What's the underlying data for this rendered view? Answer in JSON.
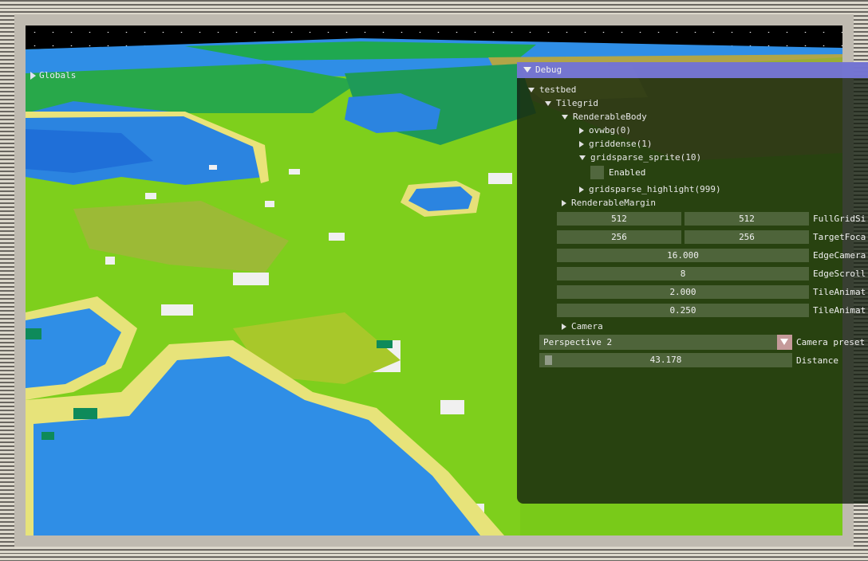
{
  "globals": {
    "label": "Globals"
  },
  "debug": {
    "title": "Debug",
    "tree": {
      "testbed": "testbed",
      "tilegrid": "Tilegrid",
      "renderable_body": "RenderableBody",
      "ovwbg": "ovwbg(0)",
      "griddense": "griddense(1)",
      "gridsparse_sprite": "gridsparse_sprite(10)",
      "enabled": "Enabled",
      "gridsparse_highlight": "gridsparse_highlight(999)",
      "renderable_margin": "RenderableMargin",
      "camera": "Camera"
    },
    "fields": {
      "full_grid_size": {
        "a": "512",
        "b": "512",
        "label": "FullGridSi"
      },
      "target_focus": {
        "a": "256",
        "b": "256",
        "label": "TargetFoca"
      },
      "edge_camera": {
        "value": "16.000",
        "label": "EdgeCamera"
      },
      "edge_scroll": {
        "value": "8",
        "label": "EdgeScroll"
      },
      "tile_anim_1": {
        "value": "2.000",
        "label": "TileAnimat"
      },
      "tile_anim_2": {
        "value": "0.250",
        "label": "TileAnimat"
      }
    },
    "camera_preset": {
      "value": "Perspective 2",
      "label": "Camera preset"
    },
    "distance": {
      "value": "43.178",
      "label": "Distance"
    }
  },
  "colors": {
    "title_bar": "#7a7ae0",
    "ocean": "#2f8ee6",
    "deep_ocean": "#1f6fd8",
    "shallows": "#e7e37a",
    "grass": "#8ad21e",
    "forest": "#10a060",
    "snow": "#f2f2f2",
    "desert": "#b3a64a"
  }
}
